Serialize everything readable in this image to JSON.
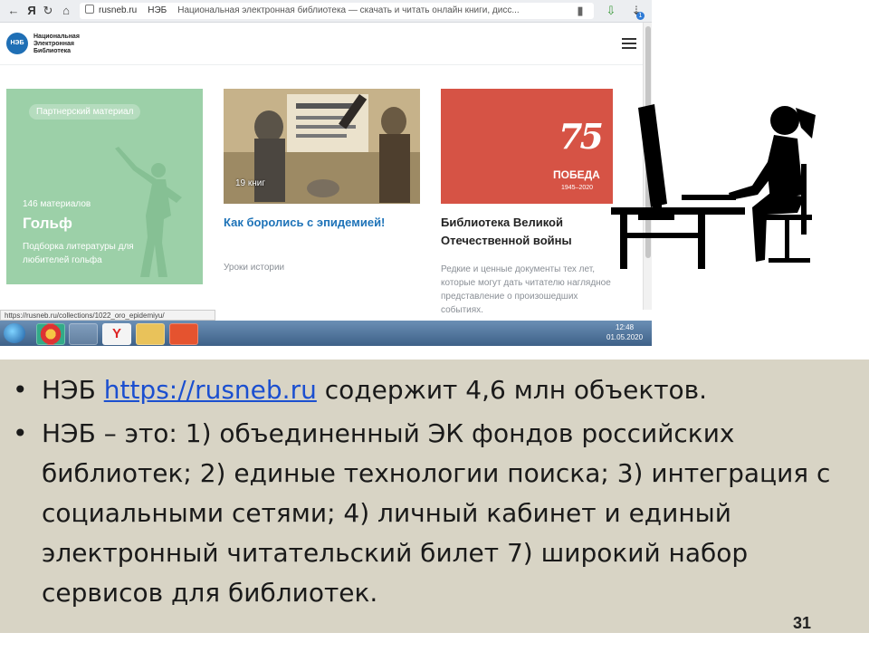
{
  "browser": {
    "domain": "rusneb.ru",
    "site_short": "НЭБ",
    "page_title": "Национальная электронная библиотека — скачать и читать онлайн книги, дисс...",
    "notification_count": "1"
  },
  "site": {
    "logo_abbr": "НЭБ",
    "logo_lines": [
      "Национальная",
      "Электронная",
      "Библиотека"
    ]
  },
  "cards": {
    "golf": {
      "badge": "Партнерский материал",
      "count": "146 материалов",
      "title": "Гольф",
      "subtitle": "Подборка литературы для любителей гольфа",
      "bg_color": "#9cd0a8"
    },
    "epidemics": {
      "books_badge": "19 книг",
      "title": "Как боролись с эпидемией!",
      "tag": "Уроки истории"
    },
    "victory": {
      "image_number": "75",
      "image_word": "ПОБЕДА",
      "image_years": "1945–2020",
      "title": "Библиотека Великой Отечественной войны",
      "description": "Редкие и ценные документы тех лет, которые могут дать читателю наглядное представление о произошедших событиях.",
      "bg_color": "#d65345"
    }
  },
  "status_url": "https://rusneb.ru/collections/1022_oro_epidemiyu/",
  "taskbar": {
    "time": "12:48",
    "date": "01.05.2020"
  },
  "slide": {
    "bullet1_prefix": "НЭБ ",
    "bullet1_link": "https://rusneb.ru",
    "bullet1_suffix": " содержит 4,6 млн объектов.",
    "bullet2": "НЭБ – это: 1) объединенный ЭК фондов российских библиотек; 2) единые технологии поиска; 3) интеграция с социальными сетями; 4) личный кабинет и единый электронный читательский билет 7) широкий набор сервисов для библиотек.",
    "page_number": "31",
    "bg_color": "#d8d4c5",
    "link_color": "#1b4fd0"
  }
}
